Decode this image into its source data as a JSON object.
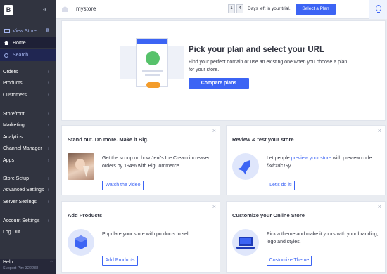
{
  "sidebar": {
    "logo": "B",
    "collapse_icon": "double-chevron-left-icon",
    "view_store": "View Store",
    "home": "Home",
    "search": "Search",
    "groups": [
      [
        "Orders",
        "Products",
        "Customers"
      ],
      [
        "Storefront",
        "Marketing",
        "Analytics",
        "Channel Manager",
        "Apps"
      ],
      [
        "Store Setup",
        "Advanced Settings",
        "Server Settings"
      ],
      [
        "Account Settings",
        "Log Out"
      ]
    ],
    "help": "Help",
    "support_pin": "Support Pin: 322238"
  },
  "topbar": {
    "store_name": "mystore",
    "trial_digits": [
      "1",
      "4"
    ],
    "trial_text": "Days left in your trial.",
    "select_plan": "Select a Plan"
  },
  "hero": {
    "title": "Pick your plan and select your URL",
    "description": "Find your perfect domain or use an existing one when you choose a plan for your store.",
    "button": "Compare plans"
  },
  "cards": {
    "standout": {
      "title": "Stand out. Do more. Make it Big.",
      "text": "Get the scoop on how Jeni's Ice Cream increased orders by 194% with BigCommerce.",
      "button": "Watch the video"
    },
    "review": {
      "title": "Review & test your store",
      "text_pre": "Let people ",
      "link": "preview your store",
      "text_post": " with preview code",
      "code": "f3drzdc19y.",
      "button": "Let's do it!"
    },
    "products": {
      "title": "Add Products",
      "text": "Populate your store with products to sell.",
      "button": "Add Products"
    },
    "customize": {
      "title": "Customize your Online Store",
      "text": "Pick a theme and make it yours with your branding, logo and styles.",
      "button": "Customize Theme"
    }
  },
  "colors": {
    "brand_blue": "#3c64f4",
    "sidebar_bg": "#313440",
    "page_bg": "#e9ecf1"
  }
}
